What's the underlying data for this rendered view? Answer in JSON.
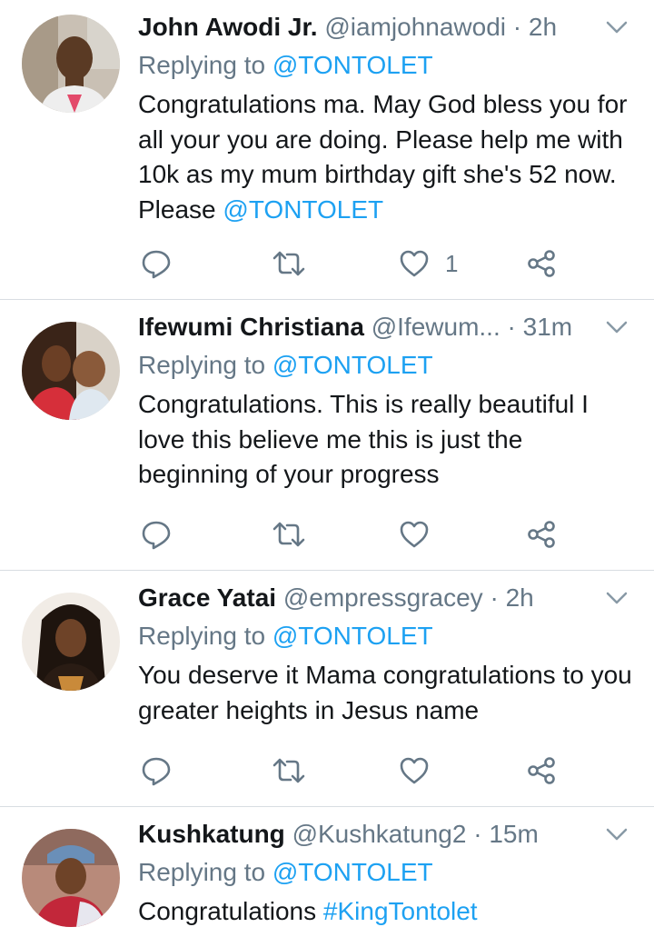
{
  "tweets": [
    {
      "name": "John Awodi Jr.",
      "handle": "@iamjohnawodi",
      "sep": " · ",
      "time": "2h",
      "reply_prefix": "Replying to ",
      "reply_to": "@TONTOLET",
      "text": "Congratulations ma. May God bless you for all your you are doing. Please help me with 10k as my mum birthday gift she's 52 now. Please ",
      "text_link": "@TONTOLET",
      "like_count": "1"
    },
    {
      "name": "Ifewumi Christiana",
      "handle": "@Ifewum...",
      "sep": " · ",
      "time": "31m",
      "reply_prefix": "Replying to ",
      "reply_to": "@TONTOLET",
      "text": "Congratulations. This is really beautiful I love this believe me this is just the beginning of your progress",
      "like_count": ""
    },
    {
      "name": "Grace Yatai",
      "handle": "@empressgracey",
      "sep": " · ",
      "time": "2h",
      "reply_prefix": "Replying to ",
      "reply_to": "@TONTOLET",
      "text": "You deserve it Mama congratulations to you greater heights in Jesus name",
      "like_count": ""
    },
    {
      "name": "Kushkatung",
      "handle": "@Kushkatung2",
      "sep": " · ",
      "time": "15m",
      "reply_prefix": "Replying to ",
      "reply_to": "@TONTOLET",
      "text": "Congratulations ",
      "text_link": "#KingTontolet"
    }
  ],
  "icons": {
    "reply": "reply-icon",
    "retweet": "retweet-icon",
    "like": "heart-icon",
    "share": "share-icon",
    "menu": "chevron-down-icon"
  },
  "colors": {
    "link": "#1da1f2",
    "secondary": "#657786",
    "text": "#14171a",
    "divider": "#d8dde2"
  }
}
